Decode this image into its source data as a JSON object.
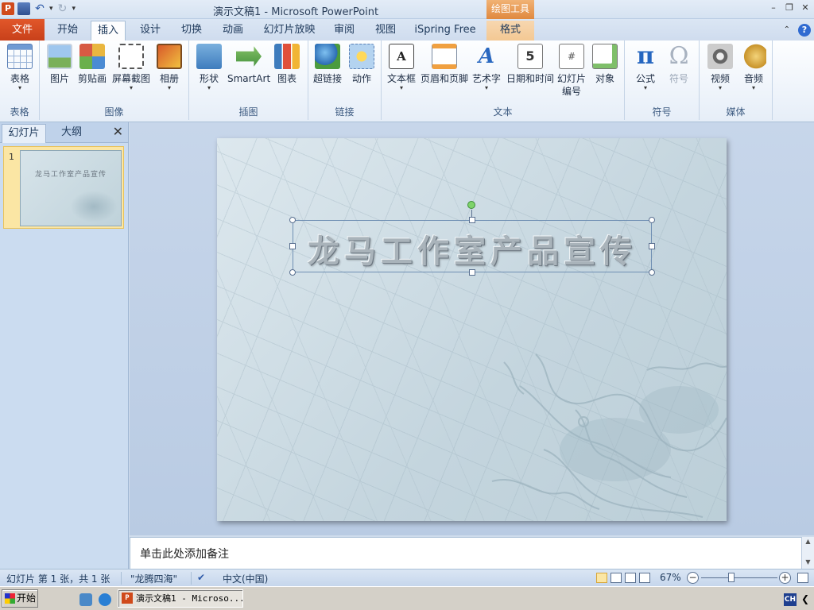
{
  "window": {
    "title": "演示文稿1 - Microsoft PowerPoint",
    "context_header": "绘图工具",
    "app_icon_letter": "P"
  },
  "tabs": {
    "file": "文件",
    "items": [
      "开始",
      "插入",
      "设计",
      "切换",
      "动画",
      "幻灯片放映",
      "审阅",
      "视图",
      "iSpring Free",
      "格式"
    ],
    "active": "插入"
  },
  "ribbon": {
    "groups": {
      "table": "表格",
      "images": "图像",
      "illustrations": "插图",
      "links": "链接",
      "text": "文本",
      "symbols": "符号",
      "media": "媒体"
    },
    "buttons": {
      "table": "表格",
      "picture": "图片",
      "clipart": "剪贴画",
      "screenshot": "屏幕截图",
      "album": "相册",
      "shapes": "形状",
      "smartart": "SmartArt",
      "chart": "图表",
      "hyperlink": "超链接",
      "action": "动作",
      "textbox": "文本框",
      "header_footer": "页眉和页脚",
      "wordart": "艺术字",
      "datetime": "日期和时间",
      "slide_number_1": "幻灯片",
      "slide_number_2": "编号",
      "object": "对象",
      "equation": "公式",
      "symbol": "符号",
      "video": "视频",
      "audio": "音频"
    },
    "icon_glyphs": {
      "textbox": "A",
      "wordart": "A",
      "datetime": "5",
      "slide_number": "#",
      "equation": "π",
      "symbol": "Ω"
    }
  },
  "left_panel": {
    "tab_slides": "幻灯片",
    "tab_outline": "大纲",
    "slide_number": "1",
    "thumbnail_title": "龙马工作室产品宣传"
  },
  "slide": {
    "title": "龙马工作室产品宣传"
  },
  "notes": {
    "placeholder": "单击此处添加备注"
  },
  "statusbar": {
    "slide_info": "幻灯片 第 1 张，共 1 张",
    "theme": "\"龙腾四海\"",
    "language": "中文(中国)",
    "zoom": "67%",
    "zoom_fraction": 0.4
  },
  "taskbar": {
    "start": "开始",
    "task_label": "演示文稿1 - Microso...",
    "ime": "CH",
    "tray_arrow": "❮"
  },
  "colors": {
    "file_tab": "#d04a1b",
    "context_tab": "#e0893f",
    "selection_border": "#6f8fb3",
    "rotation_handle": "#7ed36a"
  }
}
